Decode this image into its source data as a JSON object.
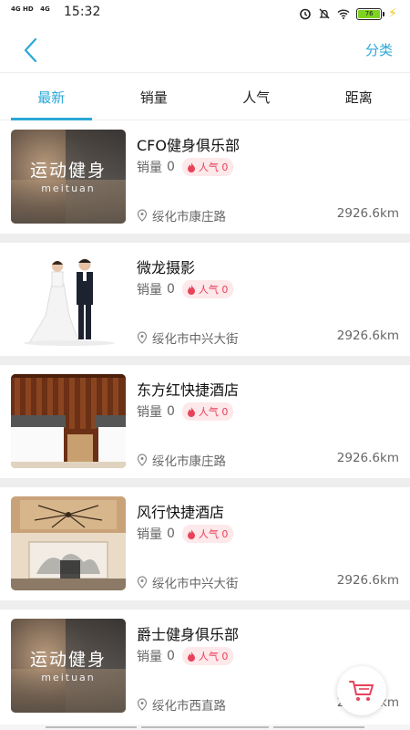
{
  "status_bar": {
    "net1": "4G HD",
    "net2": "4G",
    "time": "15:32",
    "battery": "76",
    "icons": [
      "alarm-icon",
      "mute-icon",
      "wifi-icon",
      "battery-icon",
      "charging-icon"
    ]
  },
  "header": {
    "back_icon": "chevron-left-icon",
    "right_label": "分类"
  },
  "tabs": [
    {
      "label": "最新",
      "active": true
    },
    {
      "label": "销量",
      "active": false
    },
    {
      "label": "人气",
      "active": false
    },
    {
      "label": "距离",
      "active": false
    }
  ],
  "labels": {
    "sales": "销量",
    "popularity": "人气"
  },
  "items": [
    {
      "name": "CFO健身俱乐部",
      "sales": "0",
      "popularity": "0",
      "address": "绥化市康庄路",
      "distance": "2926.6km",
      "image": "gym",
      "image_text": "运动健身",
      "image_subtext": "meituan"
    },
    {
      "name": "微龙摄影",
      "sales": "0",
      "popularity": "0",
      "address": "绥化市中兴大街",
      "distance": "2926.6km",
      "image": "wedding"
    },
    {
      "name": "东方红快捷酒店",
      "sales": "0",
      "popularity": "0",
      "address": "绥化市康庄路",
      "distance": "2926.6km",
      "image": "hotel-room"
    },
    {
      "name": "风行快捷酒店",
      "sales": "0",
      "popularity": "0",
      "address": "绥化市中兴大街",
      "distance": "2926.6km",
      "image": "hotel-lobby"
    },
    {
      "name": "爵士健身俱乐部",
      "sales": "0",
      "popularity": "0",
      "address": "绥化市西直路",
      "distance": "2926.6km",
      "image": "gym",
      "image_text": "运动健身",
      "image_subtext": "meituan"
    }
  ],
  "fab": {
    "icon": "cart-icon"
  },
  "colors": {
    "accent": "#2aa8d8",
    "badge_bg": "#fde8ea",
    "badge_text": "#e8425a",
    "cart": "#e8425a"
  }
}
